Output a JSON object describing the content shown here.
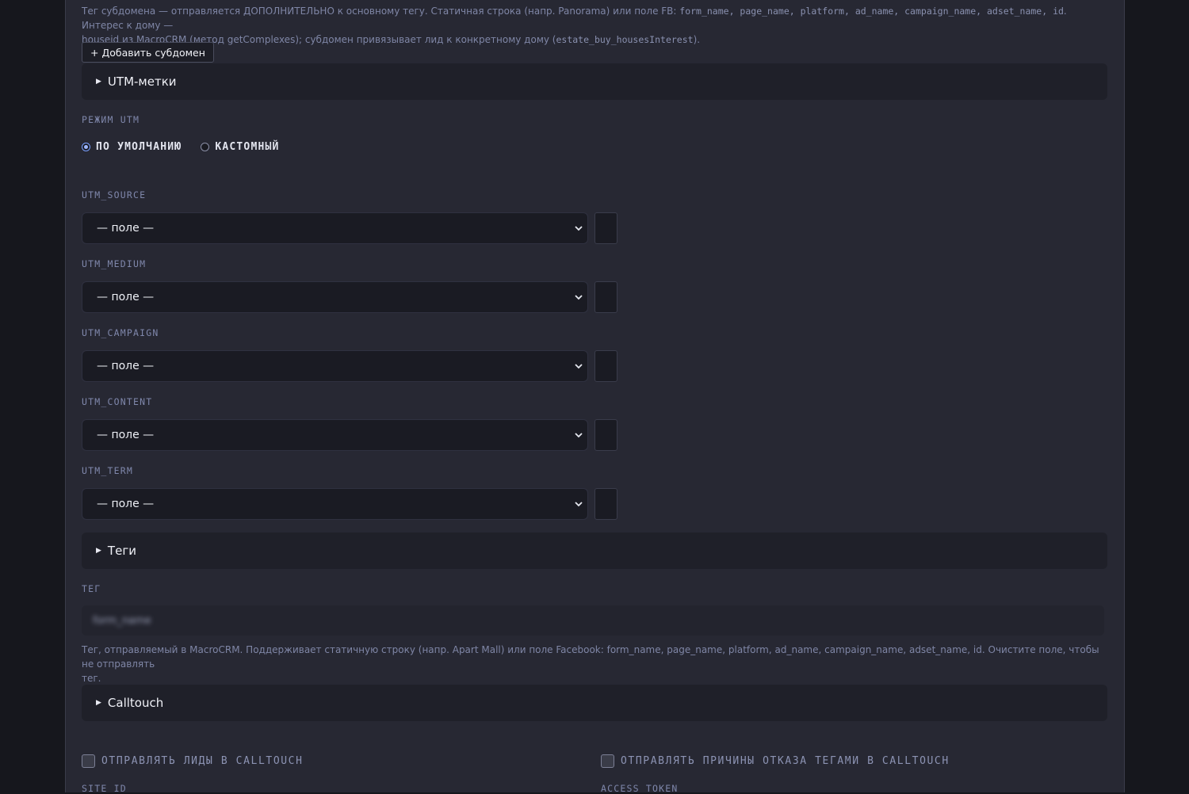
{
  "subdomain": {
    "hint_line1_a": "Тег субдомена — отправляется ДОПОЛНИТЕЛЬНО к основному тегу. Статичная строка (напр. Panorama) или поле FB: ",
    "hint_line1_fields": "form_name, page_name, platform, ad_name, campaign_name, adset_name, id",
    "hint_line1_b": ". Интерес к дому —",
    "hint_line2_a": "houseid из MacroCRM (метод getComplexes); субдомен привязывает лид к конкретному дому (",
    "hint_line2_code": "estate_buy_housesInterest",
    "hint_line2_b": ").",
    "add_button": "+ Добавить субдомен"
  },
  "utm_section": {
    "title": "UTM-метки",
    "mode_label": "Режим UTM",
    "mode_default": "По умолчанию",
    "mode_custom": "Кастомный",
    "mode_selected": "default",
    "fields": [
      {
        "label": "utm_source",
        "value": "— поле —"
      },
      {
        "label": "utm_medium",
        "value": "— поле —"
      },
      {
        "label": "utm_campaign",
        "value": "— поле —"
      },
      {
        "label": "utm_content",
        "value": "— поле —"
      },
      {
        "label": "utm_term",
        "value": "— поле —"
      }
    ]
  },
  "tags_section": {
    "title": "Теги",
    "tag_label": "Тег",
    "tag_value": "form_name",
    "hint_line1": "Тег, отправляемый в MacroCRM. Поддерживает статичную строку (напр. Apart Mall) или поле Facebook: form_name, page_name, platform, ad_name, campaign_name, adset_name, id. Очистите поле, чтобы не отправлять",
    "hint_line2": "тег."
  },
  "calltouch_section": {
    "title": "Calltouch",
    "send_leads": "Отправлять лиды в Calltouch",
    "send_reasons": "Отправлять причины отказа тегами в Calltouch",
    "site_id_label": "Site ID",
    "access_token_label": "Access token"
  },
  "icons": {
    "section_toggle": "triangle-right",
    "select_arrow": "chevron-down"
  },
  "colors": {
    "panel_bg": "#272833",
    "page_bg": "#16171d",
    "accent": "#9fb7ff",
    "label": "#7f87ab"
  }
}
